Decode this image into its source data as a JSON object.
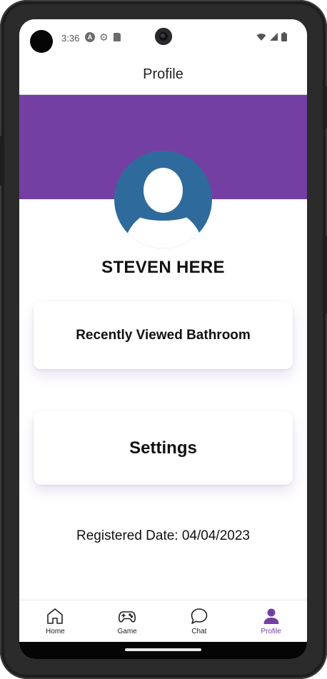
{
  "status_bar": {
    "time": "3:36",
    "icons": [
      "a-circle-icon",
      "gear-icon",
      "sd-card-icon",
      "wifi-icon",
      "signal-icon",
      "battery-icon"
    ]
  },
  "header": {
    "title": "Profile"
  },
  "profile": {
    "name": "STEVEN HERE",
    "avatar_icon": "person-avatar-icon",
    "banner_color": "#743fa3",
    "avatar_color": "#2f6a9d"
  },
  "cards": {
    "recent_label": "Recently Viewed Bathroom",
    "settings_label": "Settings"
  },
  "registered": {
    "text": "Registered Date: 04/04/2023"
  },
  "bottom_nav": {
    "items": [
      {
        "label": "Home",
        "icon": "home-icon"
      },
      {
        "label": "Game",
        "icon": "gamepad-icon"
      },
      {
        "label": "Chat",
        "icon": "chat-bubble-icon"
      },
      {
        "label": "Profile",
        "icon": "person-icon"
      }
    ],
    "active": "Profile",
    "accent_color": "#743fa3"
  }
}
